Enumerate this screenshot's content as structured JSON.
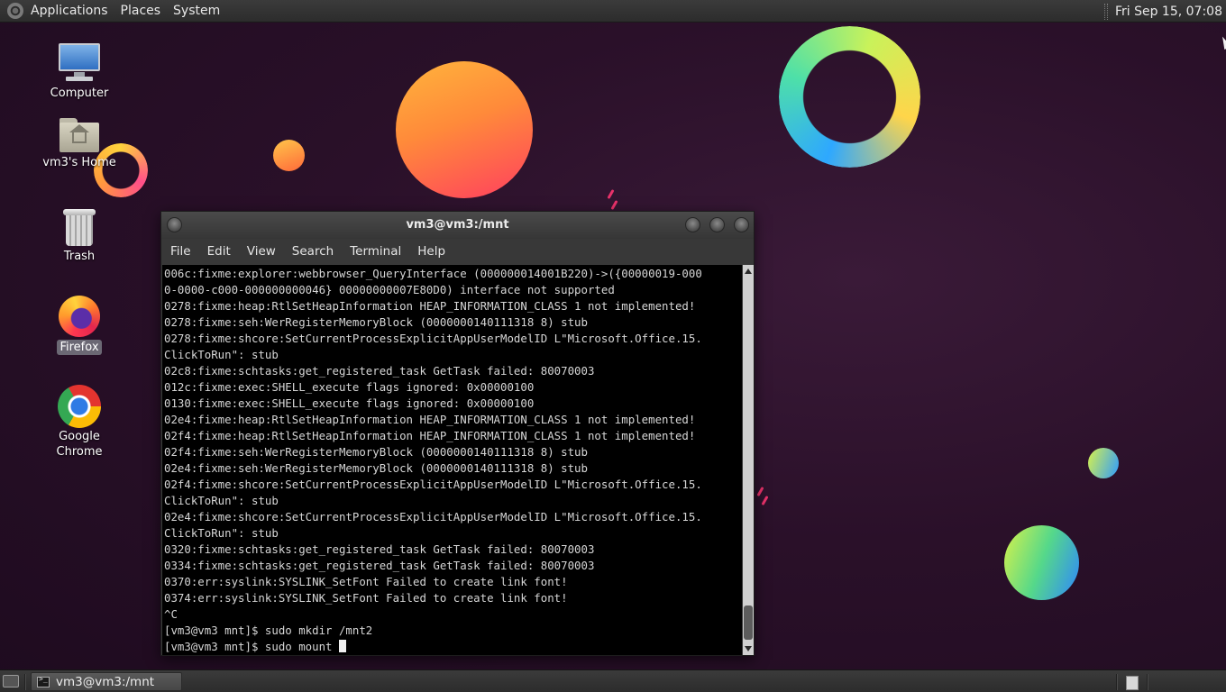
{
  "top_panel": {
    "menus": [
      "Applications",
      "Places",
      "System"
    ],
    "clock": "Fri Sep 15, 07:08"
  },
  "desktop_icons": [
    {
      "label": "Computer",
      "icon": "computer-icon"
    },
    {
      "label": "vm3's Home",
      "icon": "home-folder-icon"
    },
    {
      "label": "Trash",
      "icon": "trash-icon"
    },
    {
      "label": "Firefox",
      "icon": "firefox-icon",
      "selected": true
    },
    {
      "label": "Google Chrome",
      "icon": "chrome-icon"
    }
  ],
  "terminal": {
    "title": "vm3@vm3:/mnt",
    "menus": [
      "File",
      "Edit",
      "View",
      "Search",
      "Terminal",
      "Help"
    ],
    "lines": [
      "006c:fixme:explorer:webbrowser_QueryInterface (000000014001B220)->({00000019-000",
      "0-0000-c000-000000000046} 00000000007E80D0) interface not supported",
      "0278:fixme:heap:RtlSetHeapInformation HEAP_INFORMATION_CLASS 1 not implemented!",
      "0278:fixme:seh:WerRegisterMemoryBlock (0000000140111318 8) stub",
      "0278:fixme:shcore:SetCurrentProcessExplicitAppUserModelID L\"Microsoft.Office.15.",
      "ClickToRun\": stub",
      "02c8:fixme:schtasks:get_registered_task GetTask failed: 80070003",
      "012c:fixme:exec:SHELL_execute flags ignored: 0x00000100",
      "0130:fixme:exec:SHELL_execute flags ignored: 0x00000100",
      "02e4:fixme:heap:RtlSetHeapInformation HEAP_INFORMATION_CLASS 1 not implemented!",
      "02f4:fixme:heap:RtlSetHeapInformation HEAP_INFORMATION_CLASS 1 not implemented!",
      "02f4:fixme:seh:WerRegisterMemoryBlock (0000000140111318 8) stub",
      "02e4:fixme:seh:WerRegisterMemoryBlock (0000000140111318 8) stub",
      "02f4:fixme:shcore:SetCurrentProcessExplicitAppUserModelID L\"Microsoft.Office.15.",
      "ClickToRun\": stub",
      "02e4:fixme:shcore:SetCurrentProcessExplicitAppUserModelID L\"Microsoft.Office.15.",
      "ClickToRun\": stub",
      "0320:fixme:schtasks:get_registered_task GetTask failed: 80070003",
      "0334:fixme:schtasks:get_registered_task GetTask failed: 80070003",
      "0370:err:syslink:SYSLINK_SetFont Failed to create link font!",
      "0374:err:syslink:SYSLINK_SetFont Failed to create link font!",
      "^C",
      "[vm3@vm3 mnt]$ sudo mkdir /mnt2",
      "[vm3@vm3 mnt]$ sudo mount "
    ]
  },
  "taskbar": {
    "window_button": "vm3@vm3:/mnt"
  },
  "colors": {
    "desktop_bg": "#2a1029",
    "panel_bg": "#333333",
    "terminal_bg": "#000000",
    "terminal_fg": "#d6d6d6"
  }
}
